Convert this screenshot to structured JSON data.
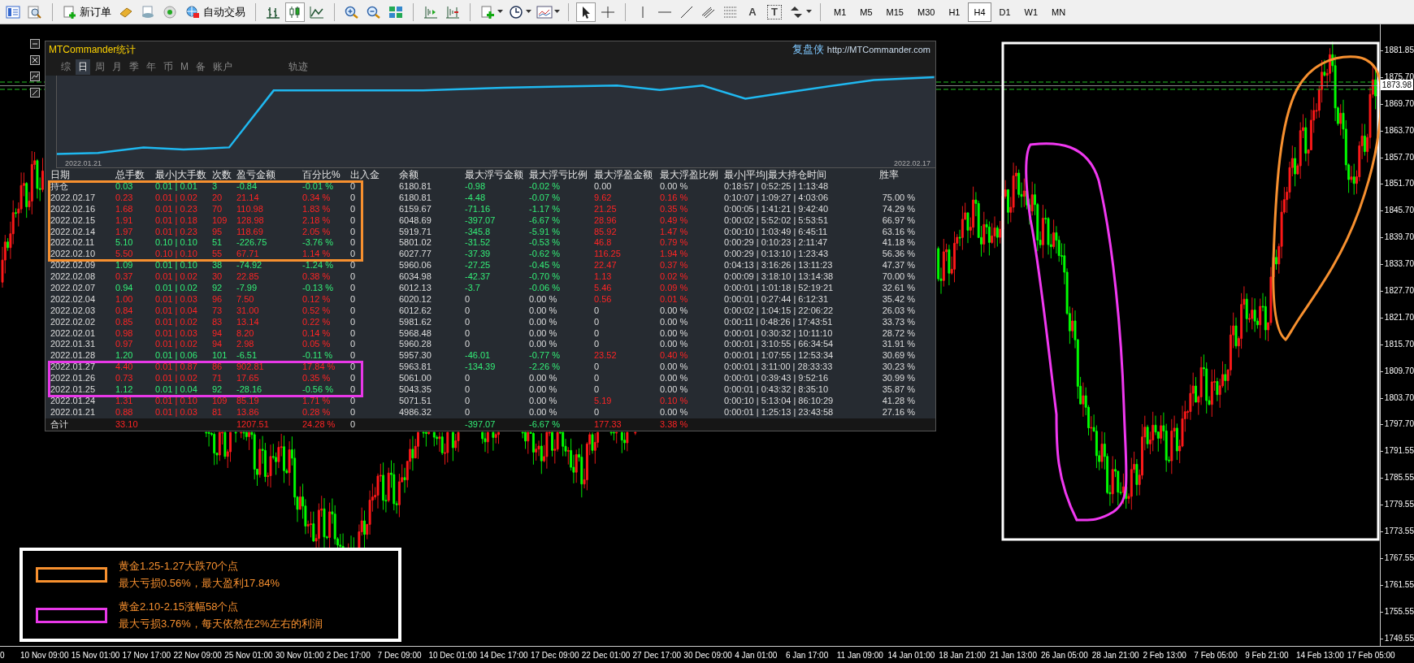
{
  "toolbar": {
    "new_order": "新订单",
    "auto_trading": "自动交易",
    "text_tool": "A",
    "label_tool": "T",
    "timeframes": [
      {
        "label": "M1",
        "selected": false
      },
      {
        "label": "M5",
        "selected": false
      },
      {
        "label": "M15",
        "selected": false
      },
      {
        "label": "M30",
        "selected": false
      },
      {
        "label": "H1",
        "selected": false
      },
      {
        "label": "H4",
        "selected": true
      },
      {
        "label": "D1",
        "selected": false
      },
      {
        "label": "W1",
        "selected": false
      },
      {
        "label": "MN",
        "selected": false
      }
    ]
  },
  "stats_panel": {
    "title": "MTCommander统计",
    "brand": "复盘侠",
    "url": "http://MTCommander.com",
    "tabs": [
      {
        "label": "综",
        "kind": "period",
        "selected": false
      },
      {
        "label": "日",
        "kind": "period",
        "selected": true
      },
      {
        "label": "周",
        "kind": "period",
        "selected": false
      },
      {
        "label": "月",
        "kind": "period",
        "selected": false
      },
      {
        "label": "季",
        "kind": "period",
        "selected": false
      },
      {
        "label": "年",
        "kind": "period",
        "selected": false
      },
      {
        "label": "币",
        "kind": "period",
        "selected": false
      },
      {
        "label": "M",
        "kind": "period",
        "selected": false
      },
      {
        "label": "备",
        "kind": "period",
        "selected": false
      },
      {
        "label": "账户",
        "kind": "period",
        "selected": false
      },
      {
        "label": "轨迹",
        "kind": "view",
        "selected": false
      }
    ],
    "equity_chart": {
      "start_label": "2022.01.21",
      "end_label": "2022.02.17"
    },
    "table": {
      "columns": [
        "日期",
        "总手数",
        "最小|大手数",
        "次数",
        "盈亏金额",
        "百分比%",
        "出入金",
        "余额",
        "最大浮亏金额",
        "最大浮亏比例",
        "最大浮盈金额",
        "最大浮盈比例",
        "最小|平均|最大持仓时间",
        "胜率"
      ],
      "row_groups": [
        {
          "color": "#f7902f",
          "rows": [
            {
              "cells": [
                "持仓",
                "0.03",
                "0.01 | 0.01",
                "3",
                "-0.84",
                "-0.01 %",
                "0",
                "6180.81",
                "-0.98",
                "-0.02 %",
                "0.00",
                "0.00 %",
                "0:18:57 | 0:52:25 | 1:13:48"
              ],
              "profit": false,
              "drawdown": true,
              "runup": false
            },
            {
              "cells": [
                "2022.02.17",
                "0.23",
                "0.01 | 0.02",
                "20",
                "21.14",
                "0.34 %",
                "0",
                "6180.81",
                "-4.48",
                "-0.07 %",
                "9.62",
                "0.16 %",
                "0:10:07 | 1:09:27 | 4:03:06",
                "75.00 %"
              ],
              "profit": true,
              "drawdown": true,
              "runup": true
            },
            {
              "cells": [
                "2022.02.16",
                "1.68",
                "0.01 | 0.23",
                "70",
                "110.98",
                "1.83 %",
                "0",
                "6159.67",
                "-71.16",
                "-1.17 %",
                "21.25",
                "0.35 %",
                "0:00:05 | 1:41:21 | 9:42:40",
                "74.29 %"
              ],
              "profit": true,
              "drawdown": true,
              "runup": true
            },
            {
              "cells": [
                "2022.02.15",
                "1.91",
                "0.01 | 0.18",
                "109",
                "128.98",
                "2.18 %",
                "0",
                "6048.69",
                "-397.07",
                "-6.67 %",
                "28.96",
                "0.49 %",
                "0:00:02 | 5:52:02 | 5:53:51",
                "66.97 %"
              ],
              "profit": true,
              "drawdown": true,
              "runup": true
            },
            {
              "cells": [
                "2022.02.14",
                "1.97",
                "0.01 | 0.23",
                "95",
                "118.69",
                "2.05 %",
                "0",
                "5919.71",
                "-345.8",
                "-5.91 %",
                "85.92",
                "1.47 %",
                "0:00:10 | 1:03:49 | 6:45:11",
                "63.16 %"
              ],
              "profit": true,
              "drawdown": true,
              "runup": true
            },
            {
              "cells": [
                "2022.02.11",
                "5.10",
                "0.10 | 0.10",
                "51",
                "-226.75",
                "-3.76 %",
                "0",
                "5801.02",
                "-31.52",
                "-0.53 %",
                "46.8",
                "0.79 %",
                "0:00:29 | 0:10:23 | 2:11:47",
                "41.18 %"
              ],
              "profit": false,
              "drawdown": true,
              "runup": true
            },
            {
              "cells": [
                "2022.02.10",
                "5.50",
                "0.10 | 0.10",
                "55",
                "67.71",
                "1.14 %",
                "0",
                "6027.77",
                "-37.39",
                "-0.62 %",
                "116.25",
                "1.94 %",
                "0:00:29 | 0:13:10 | 1:23:43",
                "56.36 %"
              ],
              "profit": true,
              "drawdown": true,
              "runup": true
            }
          ]
        },
        {
          "rows": [
            {
              "cells": [
                "2022.02.09",
                "1.09",
                "0.01 | 0.10",
                "38",
                "-74.92",
                "-1.24 %",
                "0",
                "5960.06",
                "-27.25",
                "-0.45 %",
                "22.47",
                "0.37 %",
                "0:04:13 | 3:16:26 | 13:11:23",
                "47.37 %"
              ],
              "profit": false,
              "drawdown": true,
              "runup": true
            },
            {
              "cells": [
                "2022.02.08",
                "0.37",
                "0.01 | 0.02",
                "30",
                "22.85",
                "0.38 %",
                "0",
                "6034.98",
                "-42.37",
                "-0.70 %",
                "1.13",
                "0.02 %",
                "0:00:09 | 3:18:10 | 13:14:38",
                "70.00 %"
              ],
              "profit": true,
              "drawdown": true,
              "runup": true
            },
            {
              "cells": [
                "2022.02.07",
                "0.94",
                "0.01 | 0.02",
                "92",
                "-7.99",
                "-0.13 %",
                "0",
                "6012.13",
                "-3.7",
                "-0.06 %",
                "5.46",
                "0.09 %",
                "0:00:01 | 1:01:18 | 52:19:21",
                "32.61 %"
              ],
              "profit": false,
              "drawdown": true,
              "runup": true
            },
            {
              "cells": [
                "2022.02.04",
                "1.00",
                "0.01 | 0.03",
                "96",
                "7.50",
                "0.12 %",
                "0",
                "6020.12",
                "0",
                "0.00 %",
                "0.56",
                "0.01 %",
                "0:00:01 | 0:27:44 | 6:12:31",
                "35.42 %"
              ],
              "profit": true,
              "drawdown": false,
              "runup": true
            },
            {
              "cells": [
                "2022.02.03",
                "0.84",
                "0.01 | 0.04",
                "73",
                "31.00",
                "0.52 %",
                "0",
                "6012.62",
                "0",
                "0.00 %",
                "0",
                "0.00 %",
                "0:00:02 | 1:04:15 | 22:06:22",
                "26.03 %"
              ],
              "profit": true,
              "drawdown": false,
              "runup": false
            },
            {
              "cells": [
                "2022.02.02",
                "0.85",
                "0.01 | 0.02",
                "83",
                "13.14",
                "0.22 %",
                "0",
                "5981.62",
                "0",
                "0.00 %",
                "0",
                "0.00 %",
                "0:00:11 | 0:48:26 | 17:43:51",
                "33.73 %"
              ],
              "profit": true,
              "drawdown": false,
              "runup": false
            },
            {
              "cells": [
                "2022.02.01",
                "0.98",
                "0.01 | 0.03",
                "94",
                "8.20",
                "0.14 %",
                "0",
                "5968.48",
                "0",
                "0.00 %",
                "0",
                "0.00 %",
                "0:00:01 | 0:30:32 | 10:11:10",
                "28.72 %"
              ],
              "profit": true,
              "drawdown": false,
              "runup": false
            },
            {
              "cells": [
                "2022.01.31",
                "0.97",
                "0.01 | 0.02",
                "94",
                "2.98",
                "0.05 %",
                "0",
                "5960.28",
                "0",
                "0.00 %",
                "0",
                "0.00 %",
                "0:00:01 | 3:10:55 | 66:34:54",
                "31.91 %"
              ],
              "profit": true,
              "drawdown": false,
              "runup": false
            },
            {
              "cells": [
                "2022.01.28",
                "1.20",
                "0.01 | 0.06",
                "101",
                "-6.51",
                "-0.11 %",
                "0",
                "5957.30",
                "-46.01",
                "-0.77 %",
                "23.52",
                "0.40 %",
                "0:00:01 | 1:07:55 | 12:53:34",
                "30.69 %"
              ],
              "profit": false,
              "drawdown": true,
              "runup": true
            }
          ]
        },
        {
          "color": "#e838e8",
          "rows": [
            {
              "cells": [
                "2022.01.27",
                "4.40",
                "0.01 | 0.87",
                "86",
                "902.81",
                "17.84 %",
                "0",
                "5963.81",
                "-134.39",
                "-2.26 %",
                "0",
                "0.00 %",
                "0:00:01 | 3:11:00 | 28:33:33",
                "30.23 %"
              ],
              "profit": true,
              "drawdown": true,
              "runup": false
            },
            {
              "cells": [
                "2022.01.26",
                "0.73",
                "0.01 | 0.02",
                "71",
                "17.65",
                "0.35 %",
                "0",
                "5061.00",
                "0",
                "0.00 %",
                "0",
                "0.00 %",
                "0:00:01 | 0:39:43 | 9:52:16",
                "30.99 %"
              ],
              "profit": true,
              "drawdown": false,
              "runup": false
            },
            {
              "cells": [
                "2022.01.25",
                "1.12",
                "0.01 | 0.04",
                "92",
                "-28.16",
                "-0.56 %",
                "0",
                "5043.35",
                "0",
                "0.00 %",
                "0",
                "0.00 %",
                "0:00:01 | 0:43:32 | 8:35:10",
                "35.87 %"
              ],
              "profit": false,
              "drawdown": false,
              "runup": false
            }
          ]
        },
        {
          "rows": [
            {
              "cells": [
                "2022.01.24",
                "1.31",
                "0.01 | 0.10",
                "109",
                "85.19",
                "1.71 %",
                "0",
                "5071.51",
                "0",
                "0.00 %",
                "5.19",
                "0.10 %",
                "0:00:10 | 5:13:04 | 86:10:29",
                "41.28 %"
              ],
              "profit": true,
              "drawdown": false,
              "runup": true
            },
            {
              "cells": [
                "2022.01.21",
                "0.88",
                "0.01 | 0.03",
                "81",
                "13.86",
                "0.28 %",
                "0",
                "4986.32",
                "0",
                "0.00 %",
                "0",
                "0.00 %",
                "0:00:01 | 1:25:13 | 23:43:58",
                "27.16 %"
              ],
              "profit": true,
              "drawdown": false,
              "runup": false
            }
          ]
        }
      ],
      "total": {
        "label": "合计",
        "lots": "33.10",
        "pnl": "1207.51",
        "pct": "24.28 %",
        "flow": "0",
        "max_dd": "-397.07",
        "max_dd_pct": "-6.67 %",
        "max_ru": "177.33",
        "max_ru_pct": "3.38 %"
      }
    }
  },
  "chart": {
    "current_price": "1873.98",
    "price_axis": [
      "1881.85",
      "1875.70",
      "1869.70",
      "1863.70",
      "1857.70",
      "1851.70",
      "1845.70",
      "1839.70",
      "1833.70",
      "1827.70",
      "1821.70",
      "1815.70",
      "1809.70",
      "1803.70",
      "1797.70",
      "1791.55",
      "1785.55",
      "1779.55",
      "1773.55",
      "1767.55",
      "1761.55",
      "1755.55",
      "1749.55"
    ],
    "time_axis": [
      "0",
      "10 Nov 09:00",
      "15 Nov 01:00",
      "17 Nov 17:00",
      "22 Nov 09:00",
      "25 Nov 01:00",
      "30 Nov 01:00",
      "2 Dec 17:00",
      "7 Dec 09:00",
      "10 Dec 01:00",
      "14 Dec 17:00",
      "17 Dec 09:00",
      "22 Dec 01:00",
      "27 Dec 17:00",
      "30 Dec 09:00",
      "4 Jan 01:00",
      "6 Jan 17:00",
      "11 Jan 09:00",
      "14 Jan 01:00",
      "18 Jan 21:00",
      "21 Jan 13:00",
      "26 Jan 05:00",
      "28 Jan 21:00",
      "2 Feb 13:00",
      "7 Feb 05:00",
      "9 Feb 21:00",
      "14 Feb 13:00",
      "17 Feb 05:00"
    ],
    "notes": [
      {
        "color": "#f7902f",
        "lines": [
          "黄金1.25-1.27大跌70个点",
          "最大亏损0.56%，最大盈利17.84%"
        ]
      },
      {
        "color": "#e838e8",
        "lines": [
          "黄金2.10-2.15涨幅58个点",
          "最大亏损3.76%，每天依然在2%左右的利润"
        ]
      }
    ]
  }
}
